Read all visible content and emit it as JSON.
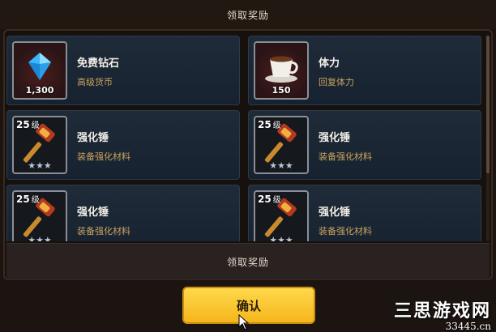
{
  "header": {
    "title": "领取奖励"
  },
  "rewards": [
    {
      "name": "免费钻石",
      "desc": "高级货币",
      "qty": "1,300",
      "icon": "diamond-icon"
    },
    {
      "name": "体力",
      "desc": "回复体力",
      "qty": "150",
      "icon": "coffee-cup-icon"
    },
    {
      "name": "强化锤",
      "desc": "装备强化材料",
      "level": "25",
      "level_unit": "级",
      "stars": "★★★",
      "icon": "hammer-icon"
    },
    {
      "name": "强化锤",
      "desc": "装备强化材料",
      "level": "25",
      "level_unit": "级",
      "stars": "★★★",
      "icon": "hammer-icon"
    },
    {
      "name": "强化锤",
      "desc": "装备强化材料",
      "level": "25",
      "level_unit": "级",
      "stars": "★★★",
      "icon": "hammer-icon"
    },
    {
      "name": "强化锤",
      "desc": "装备强化材料",
      "level": "25",
      "level_unit": "级",
      "stars": "★★★",
      "icon": "hammer-icon"
    }
  ],
  "claim_bar": {
    "label": "领取奖励"
  },
  "confirm_button": {
    "label": "确认"
  },
  "watermark": {
    "line1": "三思游戏网",
    "line2": "33445.cn"
  },
  "colors": {
    "accent": "#f5b61c",
    "desc_text": "#c9a25e",
    "card_bg": "#1f2b38"
  }
}
